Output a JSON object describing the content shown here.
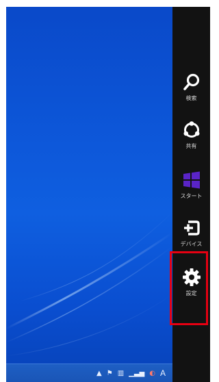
{
  "charms": [
    {
      "label": "検索",
      "icon": "search-icon"
    },
    {
      "label": "共有",
      "icon": "share-icon"
    },
    {
      "label": "スタート",
      "icon": "windows-logo-icon"
    },
    {
      "label": "デバイス",
      "icon": "devices-icon"
    },
    {
      "label": "設定",
      "icon": "gear-icon"
    }
  ],
  "taskbar": {
    "ime_label": "A"
  },
  "colors": {
    "charm_bar": "#121212",
    "desktop_blue": "#0d57d9",
    "start_logo": "#5a24c7",
    "highlight": "#e60012"
  }
}
